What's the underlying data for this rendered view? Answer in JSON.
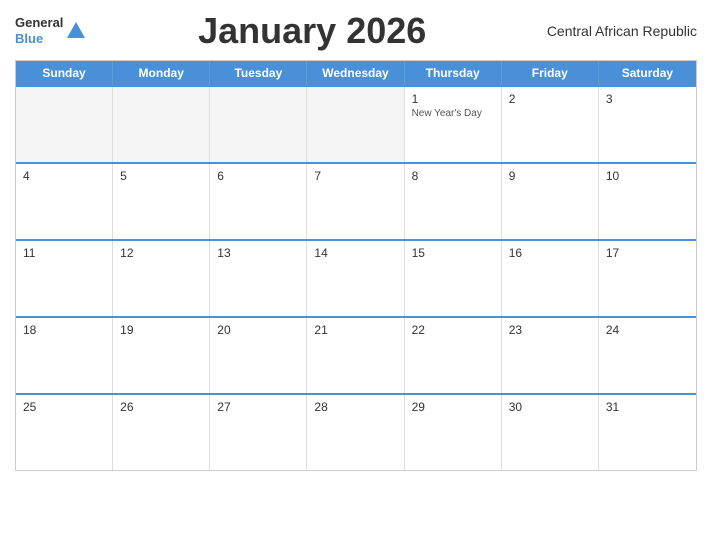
{
  "header": {
    "logo_general": "General",
    "logo_blue": "Blue",
    "title": "January 2026",
    "country": "Central African Republic"
  },
  "day_headers": [
    "Sunday",
    "Monday",
    "Tuesday",
    "Wednesday",
    "Thursday",
    "Friday",
    "Saturday"
  ],
  "weeks": [
    [
      {
        "day": "",
        "empty": true
      },
      {
        "day": "",
        "empty": true
      },
      {
        "day": "",
        "empty": true
      },
      {
        "day": "",
        "empty": true
      },
      {
        "day": "1",
        "holiday": "New Year's Day"
      },
      {
        "day": "2"
      },
      {
        "day": "3"
      }
    ],
    [
      {
        "day": "4"
      },
      {
        "day": "5"
      },
      {
        "day": "6"
      },
      {
        "day": "7"
      },
      {
        "day": "8"
      },
      {
        "day": "9"
      },
      {
        "day": "10"
      }
    ],
    [
      {
        "day": "11"
      },
      {
        "day": "12"
      },
      {
        "day": "13"
      },
      {
        "day": "14"
      },
      {
        "day": "15"
      },
      {
        "day": "16"
      },
      {
        "day": "17"
      }
    ],
    [
      {
        "day": "18"
      },
      {
        "day": "19"
      },
      {
        "day": "20"
      },
      {
        "day": "21"
      },
      {
        "day": "22"
      },
      {
        "day": "23"
      },
      {
        "day": "24"
      }
    ],
    [
      {
        "day": "25"
      },
      {
        "day": "26"
      },
      {
        "day": "27"
      },
      {
        "day": "28"
      },
      {
        "day": "29"
      },
      {
        "day": "30"
      },
      {
        "day": "31"
      }
    ]
  ]
}
